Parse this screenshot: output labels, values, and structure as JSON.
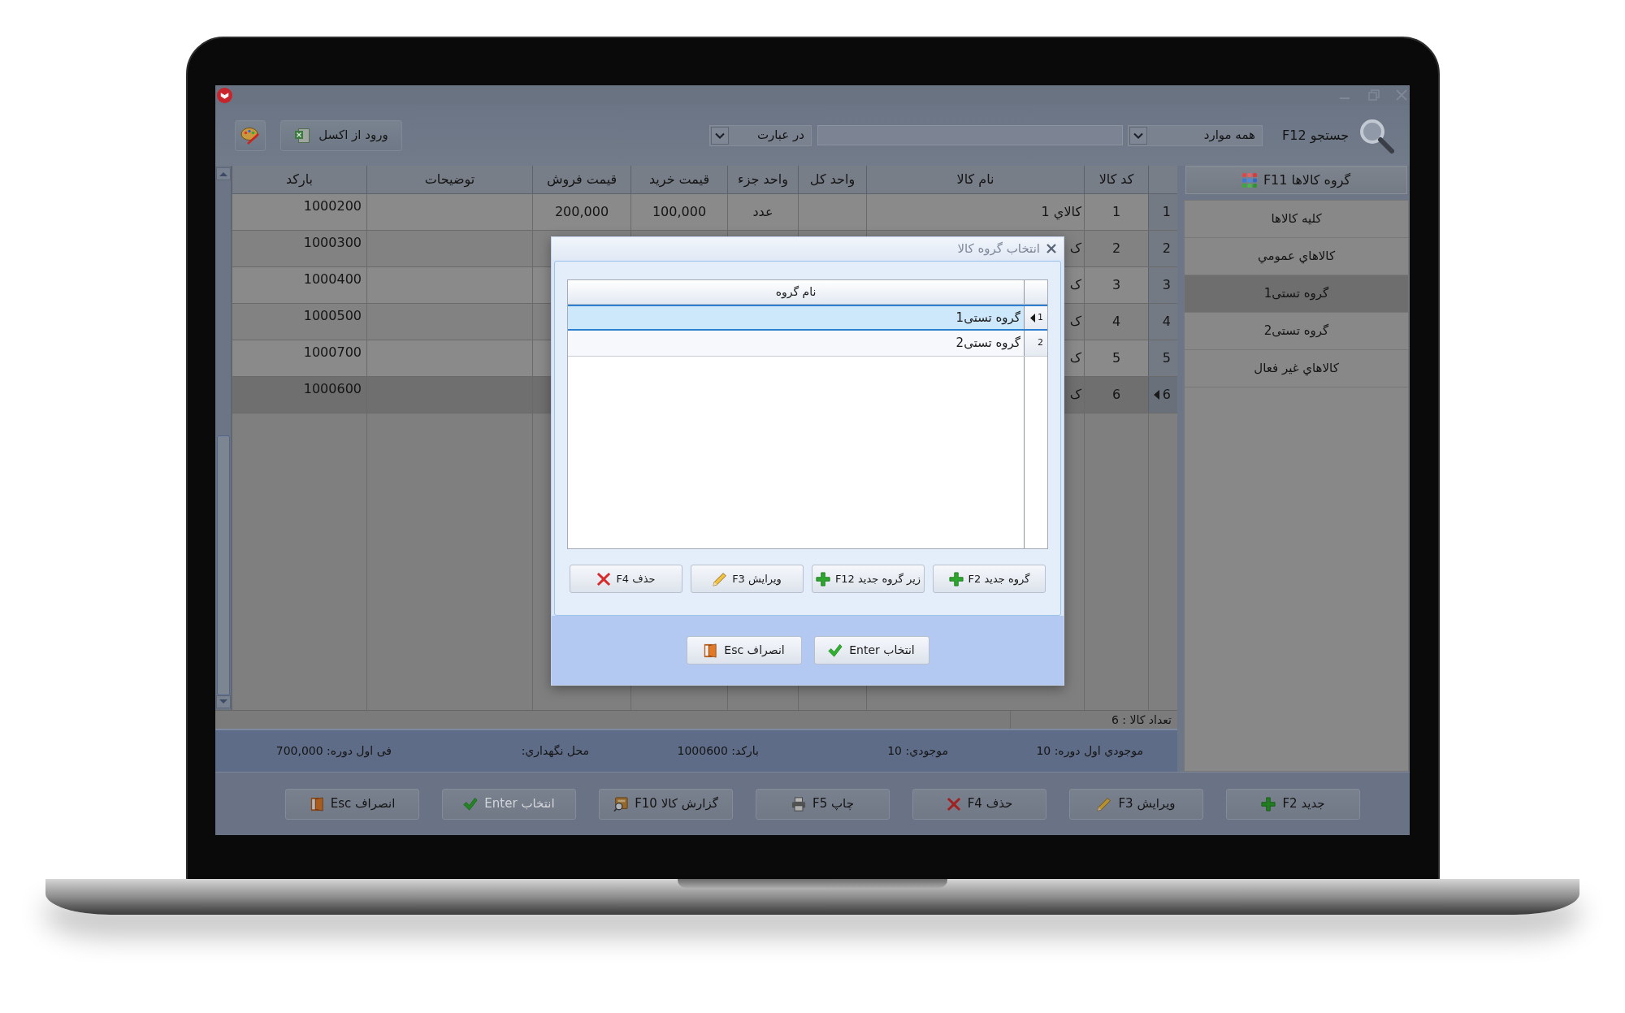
{
  "toolbar": {
    "import_button": "ورود از اکسل",
    "match_dropdown": "در عبارت",
    "scope_dropdown": "همه موارد",
    "search_label": "جستجو F12"
  },
  "table": {
    "columns": [
      "کد کالا",
      "نام کالا",
      "واحد کل",
      "واحد جزء",
      "قیمت خرید",
      "قیمت فروش",
      "توضیحات",
      "بارکد"
    ],
    "rows": [
      {
        "index": "1",
        "selected": false,
        "cells": [
          "1",
          "کالاي 1",
          null,
          "عدد",
          "100,000",
          "200,000",
          null,
          "1000200"
        ]
      },
      {
        "index": "2",
        "selected": false,
        "cells": [
          "2",
          "ک",
          null,
          null,
          null,
          null,
          null,
          "1000300"
        ]
      },
      {
        "index": "3",
        "selected": false,
        "cells": [
          "3",
          "ک",
          null,
          null,
          null,
          null,
          null,
          "1000400"
        ]
      },
      {
        "index": "4",
        "selected": false,
        "cells": [
          "4",
          "ک",
          null,
          null,
          null,
          null,
          null,
          "1000500"
        ]
      },
      {
        "index": "5",
        "selected": false,
        "cells": [
          "5",
          "ک",
          null,
          null,
          null,
          null,
          null,
          "1000700"
        ]
      },
      {
        "index": "6",
        "selected": true,
        "cells": [
          "6",
          "ک",
          null,
          null,
          null,
          null,
          null,
          "1000600"
        ]
      }
    ],
    "count": "تعداد کالا : 6"
  },
  "status": [
    "موجودي اول دوره: 10",
    "موجودي: 10",
    "بارکد: 1000600",
    "محل نگهداري:",
    "فی اول دوره: 700,000"
  ],
  "sidebar": {
    "header": "گروه کالاها F11",
    "items": [
      {
        "label": "کلیه کالاها",
        "selected": false
      },
      {
        "label": "کالاهاي عمومي",
        "selected": false
      },
      {
        "label": "گروه تستی1",
        "selected": true
      },
      {
        "label": "گروه تستی2",
        "selected": false
      },
      {
        "label": "کالاهاي غير فعال",
        "selected": false
      }
    ]
  },
  "buttons": [
    {
      "label": "جدید F2",
      "kind": "plus",
      "disabled": false
    },
    {
      "label": "ویرایش F3",
      "kind": "pencil",
      "disabled": false
    },
    {
      "label": "حذف F4",
      "kind": "cross",
      "disabled": false
    },
    {
      "label": "چاپ F5",
      "kind": "printer",
      "disabled": false
    },
    {
      "label": "گزارش کالا F10",
      "kind": "report",
      "disabled": false
    },
    {
      "label": "انتخاب Enter",
      "kind": "check",
      "disabled": true
    },
    {
      "label": "انصراف Esc",
      "kind": "door",
      "disabled": false
    }
  ],
  "dialog": {
    "title": "انتخاب گروه کالا",
    "column": "نام گروه",
    "rows": [
      {
        "index": "1",
        "name": "گروه تستی1",
        "selected": true
      },
      {
        "index": "2",
        "name": "گروه تستی2",
        "selected": false
      }
    ],
    "buttons": [
      {
        "label": "گروه جدید F2",
        "kind": "plus"
      },
      {
        "label": "زیر گروه جدید F12",
        "kind": "plus"
      },
      {
        "label": "ویرایش F3",
        "kind": "pencil"
      },
      {
        "label": "حذف F4",
        "kind": "cross"
      }
    ],
    "footer_buttons": [
      {
        "label": "انتخاب Enter",
        "kind": "check"
      },
      {
        "label": "انصراف Esc",
        "kind": "door"
      }
    ]
  }
}
